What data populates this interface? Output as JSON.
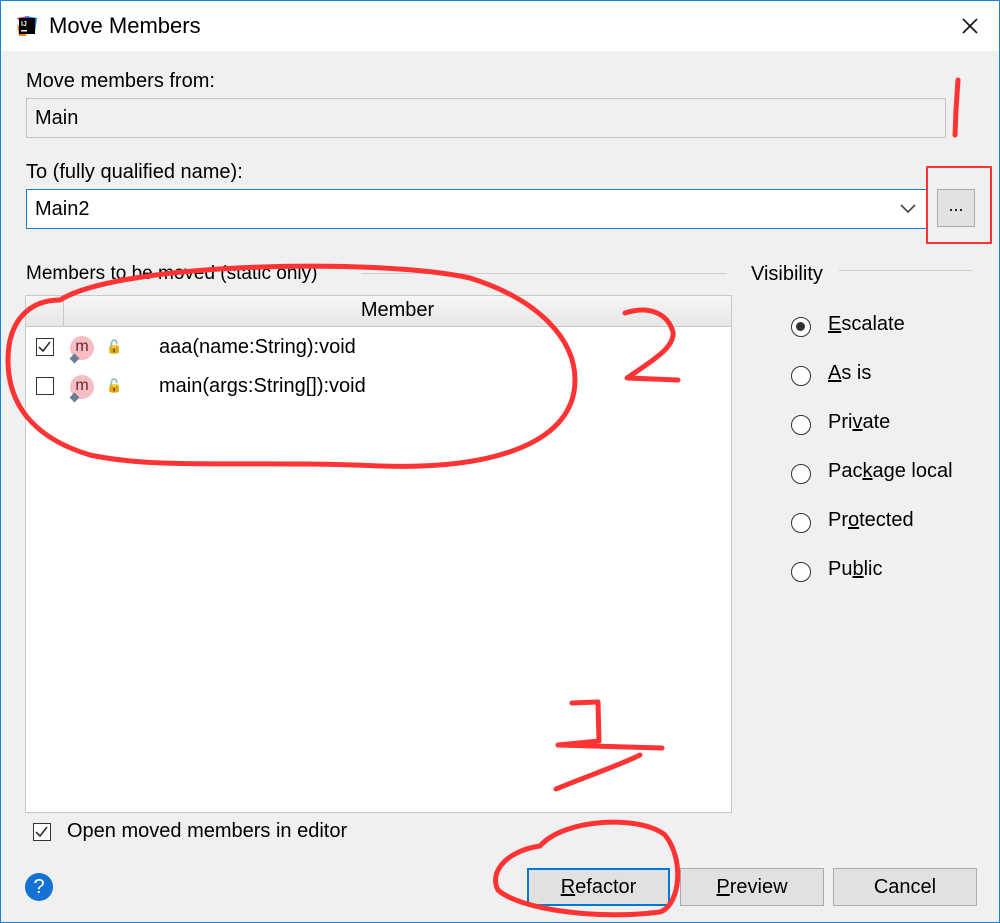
{
  "window": {
    "title": "Move Members",
    "app_icon": "intellij-idea-icon",
    "close_icon": "close-icon"
  },
  "from": {
    "label": "Move members from:",
    "value": "Main"
  },
  "to": {
    "label": "To (fully qualified name):",
    "value": "Main2",
    "browse_label": "..."
  },
  "members": {
    "section_label": "Members to be moved (static only)",
    "column_header": "Member",
    "rows": [
      {
        "checked": true,
        "icon": "m",
        "signature": "aaa(name:String):void"
      },
      {
        "checked": false,
        "icon": "m",
        "signature": "main(args:String[]):void"
      }
    ]
  },
  "visibility": {
    "label": "Visibility",
    "selected": "Escalate",
    "options": [
      {
        "pre": "",
        "mn": "E",
        "post": "scalate",
        "selected": true
      },
      {
        "pre": "",
        "mn": "A",
        "post": "s is",
        "selected": false
      },
      {
        "pre": "Pri",
        "mn": "v",
        "post": "ate",
        "selected": false
      },
      {
        "pre": "Pac",
        "mn": "k",
        "post": "age local",
        "selected": false
      },
      {
        "pre": "Pr",
        "mn": "o",
        "post": "tected",
        "selected": false
      },
      {
        "pre": "Pu",
        "mn": "b",
        "post": "lic",
        "selected": false
      }
    ]
  },
  "open_in_editor": {
    "label": "Open moved members in editor",
    "checked": true
  },
  "buttons": {
    "help": "?",
    "refactor": {
      "mn": "R",
      "rest": "efactor"
    },
    "preview": {
      "mn": "P",
      "rest": "review"
    },
    "cancel": "Cancel"
  },
  "annotations": {
    "color": "#ff3333",
    "step_1": "1",
    "step_2": "2",
    "step_3": "3"
  }
}
